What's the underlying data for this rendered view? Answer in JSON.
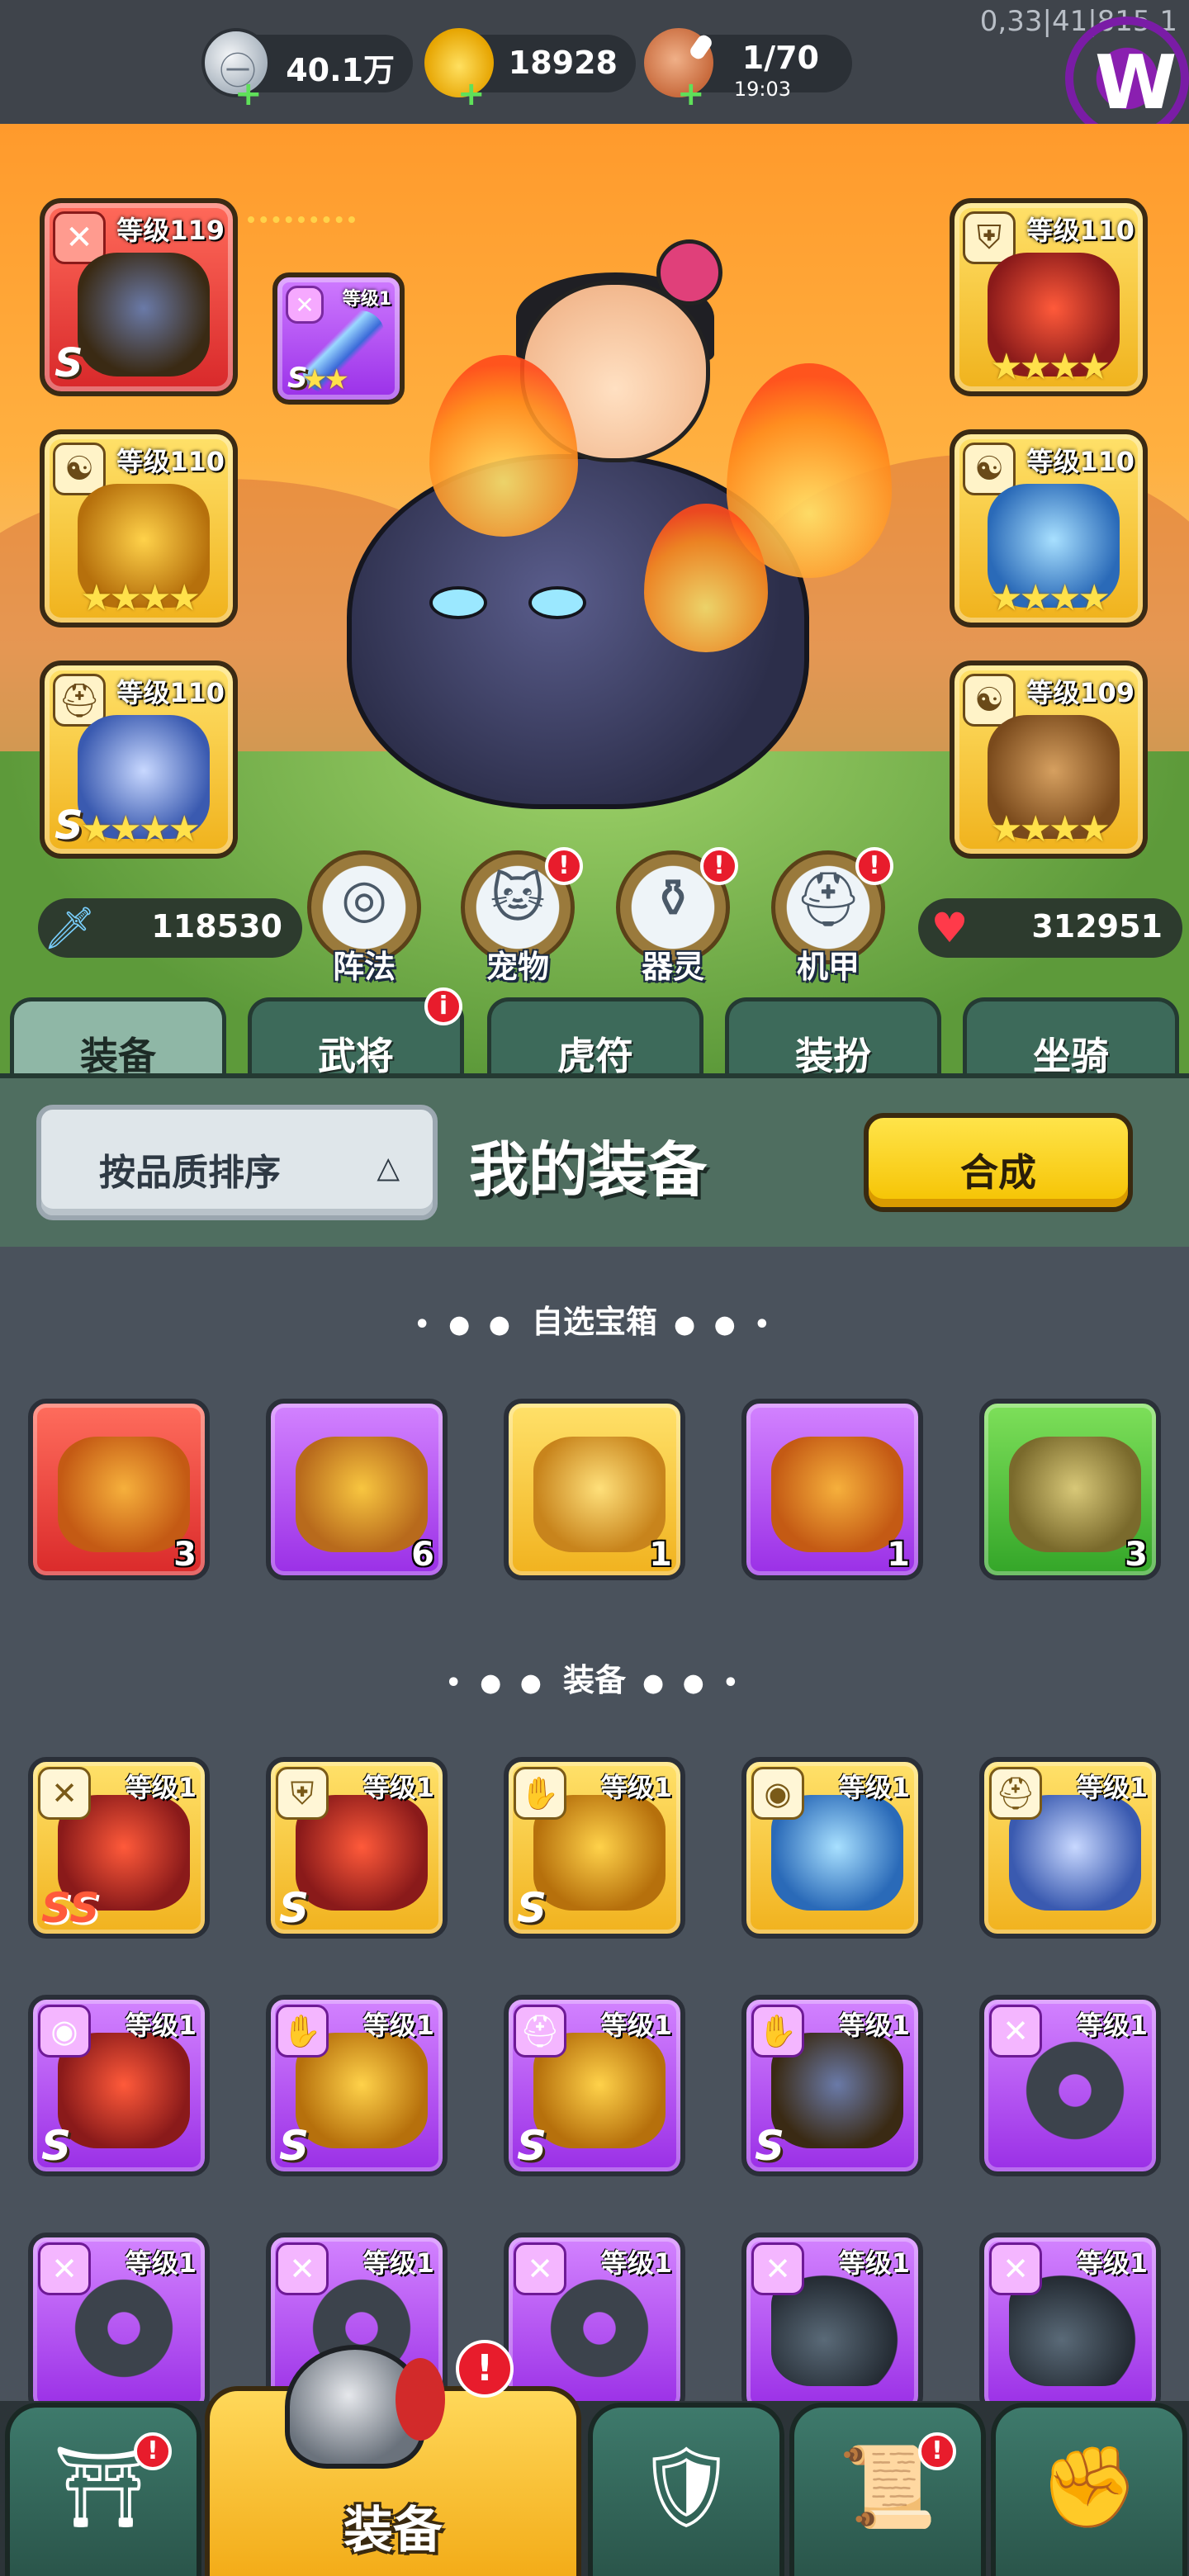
{
  "topbar": {
    "silver": "40.1万",
    "gold": "18928",
    "stamina": "1/70",
    "stamina_timer": "19:03",
    "plus": "+",
    "debug_text": "0,33|41|815 1"
  },
  "hero_slots": [
    {
      "level": "等级119",
      "grade": "S",
      "color": "red",
      "type_icon": "sword-icon"
    },
    {
      "level": "等级1",
      "grade": "S",
      "stars": "★★",
      "color": "purple",
      "type_icon": "sword-icon"
    },
    {
      "level": "等级110",
      "stars": "★★★★",
      "color": "gold",
      "type_icon": "yinyang-icon"
    },
    {
      "level": "等级110",
      "grade": "S",
      "stars": "★★★★",
      "color": "gold",
      "type_icon": "helmet-icon"
    },
    {
      "level": "等级110",
      "stars": "★★★★",
      "color": "gold",
      "type_icon": "armor-icon"
    },
    {
      "level": "等级110",
      "stars": "★★★★",
      "color": "gold",
      "type_icon": "yinyang-icon"
    },
    {
      "level": "等级109",
      "stars": "★★★★",
      "color": "gold",
      "type_icon": "yinyang-icon"
    }
  ],
  "stats": {
    "power": "118530",
    "hp": "312951"
  },
  "features": [
    {
      "label": "阵法",
      "badge": false
    },
    {
      "label": "宠物",
      "badge": true
    },
    {
      "label": "器灵",
      "badge": true
    },
    {
      "label": "机甲",
      "badge": true
    }
  ],
  "tabs": [
    {
      "label": "装备",
      "active": true
    },
    {
      "label": "武将",
      "badge": true
    },
    {
      "label": "虎符"
    },
    {
      "label": "装扮"
    },
    {
      "label": "坐骑"
    }
  ],
  "panel": {
    "sort_label": "按品质排序",
    "sort_arrow": "△",
    "title": "我的装备",
    "synth_label": "合成"
  },
  "sections": {
    "chests_title": "自选宝箱",
    "equip_title": "装备",
    "dots_left": "• ● ●",
    "dots_right": "● ● •"
  },
  "chests": [
    {
      "count": "3",
      "color": "red"
    },
    {
      "count": "6",
      "color": "purple"
    },
    {
      "count": "1",
      "color": "gold"
    },
    {
      "count": "1",
      "color": "purple"
    },
    {
      "count": "3",
      "color": "green"
    }
  ],
  "equipment": [
    {
      "level": "等级1",
      "grade": "SS",
      "color": "gold",
      "type_icon": "sword-icon"
    },
    {
      "level": "等级1",
      "grade": "S",
      "color": "gold",
      "type_icon": "armor-icon"
    },
    {
      "level": "等级1",
      "grade": "S",
      "color": "gold",
      "type_icon": "gauntlet-icon"
    },
    {
      "level": "等级1",
      "grade": "",
      "color": "gold",
      "type_icon": "necklace-icon"
    },
    {
      "level": "等级1",
      "grade": "",
      "color": "gold",
      "type_icon": "helmet-icon"
    },
    {
      "level": "等级1",
      "grade": "S",
      "color": "purple",
      "type_icon": "necklace-icon"
    },
    {
      "level": "等级1",
      "grade": "S",
      "color": "purple",
      "type_icon": "gauntlet-icon"
    },
    {
      "level": "等级1",
      "grade": "S",
      "color": "purple",
      "type_icon": "helmet-icon"
    },
    {
      "level": "等级1",
      "grade": "S",
      "color": "purple",
      "type_icon": "gauntlet-icon"
    },
    {
      "level": "等级1",
      "grade": "",
      "color": "purple",
      "type_icon": "sword-icon"
    },
    {
      "level": "等级1",
      "grade": "",
      "color": "purple",
      "type_icon": "sword-icon"
    },
    {
      "level": "等级1",
      "grade": "",
      "color": "purple",
      "type_icon": "sword-icon"
    },
    {
      "level": "等级1",
      "grade": "",
      "color": "purple",
      "type_icon": "sword-icon"
    },
    {
      "level": "等级1",
      "grade": "",
      "color": "purple",
      "type_icon": "sword-icon"
    },
    {
      "level": "等级1",
      "grade": "",
      "color": "purple",
      "type_icon": "sword-icon"
    }
  ],
  "bottom_nav": [
    {
      "name": "gate-icon",
      "badge": true
    },
    {
      "label": "装备",
      "active": true,
      "badge": true
    },
    {
      "name": "shield-icon"
    },
    {
      "name": "scroll-icon",
      "badge": true
    },
    {
      "name": "fist-icon"
    }
  ],
  "colors": {
    "accent": "#f5c200",
    "tab_bg": "#3d6a5a",
    "badge": "#e81c2c"
  }
}
